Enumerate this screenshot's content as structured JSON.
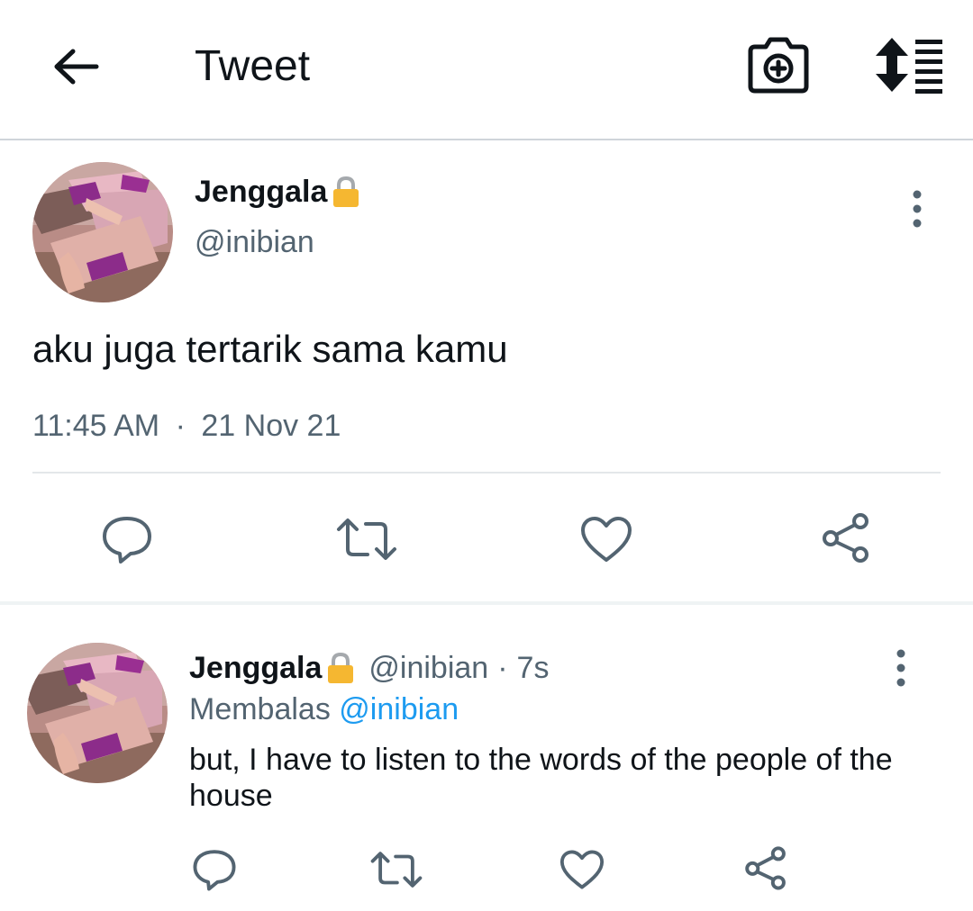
{
  "header": {
    "title": "Tweet",
    "back_icon": "arrow-left-icon",
    "camera_icon": "camera-plus-icon",
    "sort_icon": "sort-list-icon"
  },
  "main_tweet": {
    "display_name": "Jenggala",
    "locked": true,
    "handle": "@inibian",
    "text": "aku juga tertarik sama kamu",
    "time": "11:45 AM",
    "separator": "·",
    "date": "21 Nov 21"
  },
  "reply": {
    "display_name": "Jenggala",
    "locked": true,
    "handle": "@inibian",
    "separator": "·",
    "time": "7s",
    "replying_prefix": "Membalas",
    "replying_to": "@inibian",
    "text": "but, I have to listen to the words of the people of the house"
  },
  "colors": {
    "text_primary": "#0f1419",
    "text_secondary": "#536471",
    "link": "#1d9bf0",
    "icon_gray": "#536471",
    "lock": "#f5b731"
  }
}
